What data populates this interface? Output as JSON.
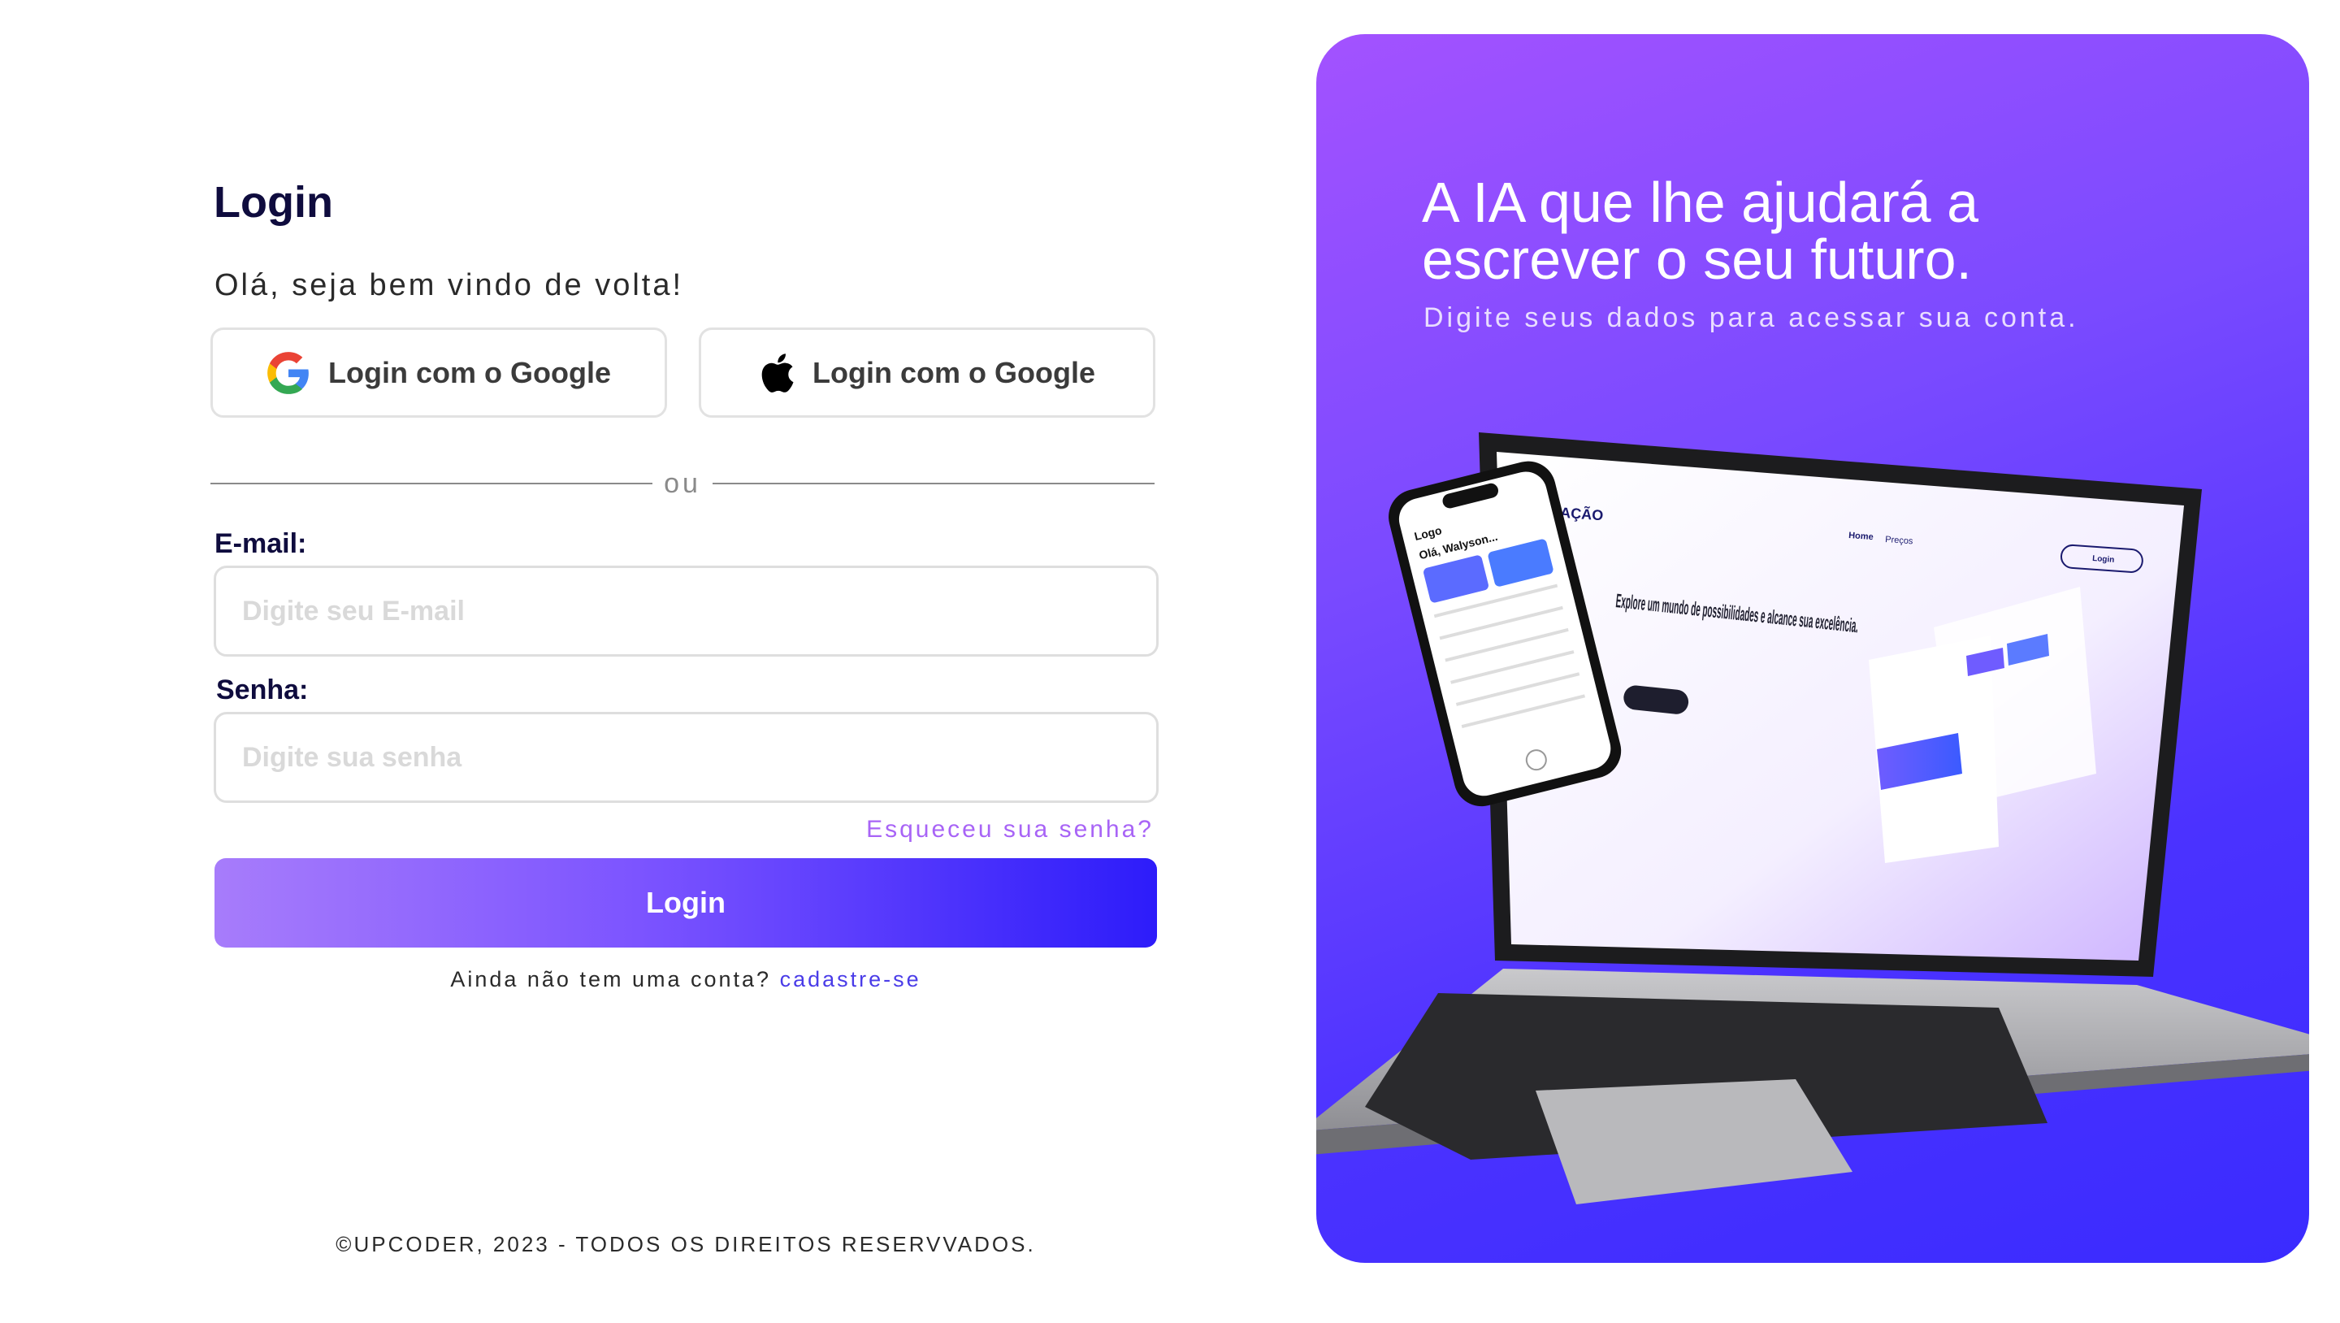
{
  "login": {
    "title": "Login",
    "welcome": "Olá, seja bem vindo de volta!",
    "google_button": "Login com o Google",
    "apple_button": "Login com o Google",
    "divider": "ou",
    "email_label": "E-mail:",
    "email_placeholder": "Digite seu E-mail",
    "email_value": "",
    "password_label": "Senha:",
    "password_placeholder": "Digite sua senha",
    "password_value": "",
    "forgot": "Esqueceu sua senha?",
    "submit": "Login",
    "signup_prompt": "Ainda não tem uma conta?",
    "signup_link": "cadastre-se"
  },
  "footer": {
    "copyright": "©UPCODER, 2023 - TODOS OS DIREITOS RESERVVADOS."
  },
  "hero": {
    "title": "A IA que lhe ajudará a escrever o seu futuro.",
    "subtitle": "Digite seus dados para acessar sua conta.",
    "mockup": {
      "laptop_logo": "REDAÇÃO",
      "laptop_nav_home": "Home",
      "laptop_nav_prices": "Preços",
      "laptop_login": "Login",
      "laptop_headline": "Explore um mundo de possibilidades e alcance sua excelência.",
      "phone_logo": "Logo",
      "phone_greeting": "Olá, Walyson..."
    }
  },
  "colors": {
    "brand_dark": "#0f0c3e",
    "accent": "#7c54ff",
    "link": "#4a3ce8",
    "forgot": "#a864f6"
  },
  "icons": {
    "google": "google-logo-icon",
    "apple": "apple-logo-icon"
  }
}
